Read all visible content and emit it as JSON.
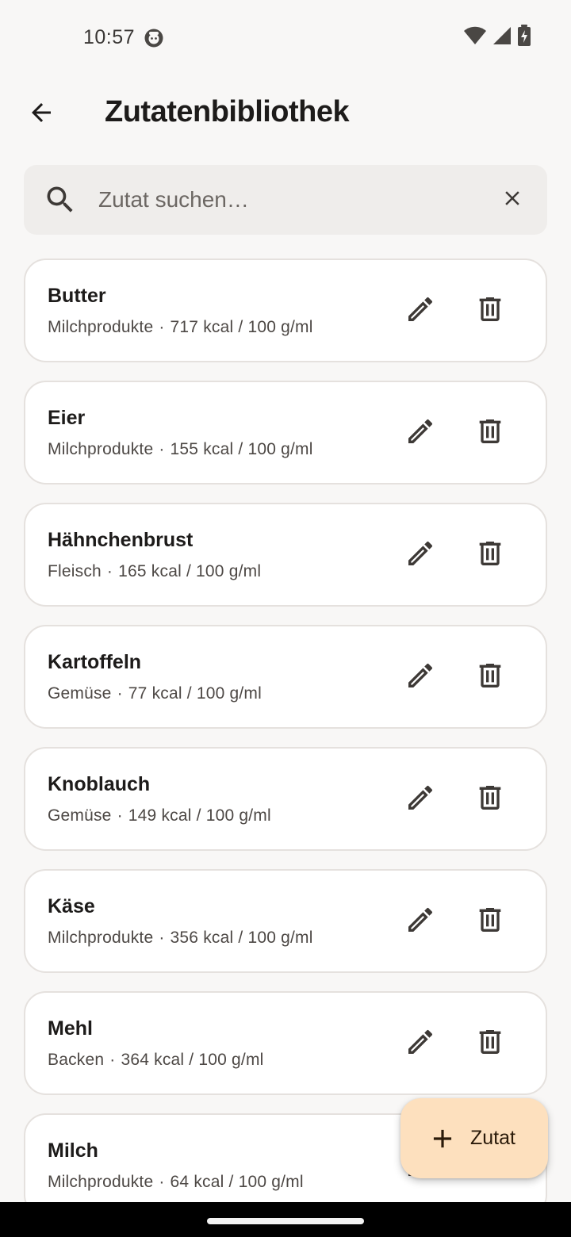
{
  "status_bar": {
    "time": "10:57",
    "icons": [
      "app-notification-icon",
      "wifi-icon",
      "cell-signal-icon",
      "battery-charging-icon"
    ]
  },
  "app_bar": {
    "back_icon": "arrow-back-icon",
    "title": "Zutatenbibliothek"
  },
  "search": {
    "placeholder": "Zutat suchen…",
    "value": "",
    "icon": "search-icon",
    "clear_icon": "close-icon"
  },
  "ingredients": [
    {
      "name": "Butter",
      "category": "Milchprodukte",
      "kcal": "717 kcal / 100 g/ml"
    },
    {
      "name": "Eier",
      "category": "Milchprodukte",
      "kcal": "155 kcal / 100 g/ml"
    },
    {
      "name": "Hähnchenbrust",
      "category": "Fleisch",
      "kcal": "165 kcal / 100 g/ml"
    },
    {
      "name": "Kartoffeln",
      "category": "Gemüse",
      "kcal": "77 kcal / 100 g/ml"
    },
    {
      "name": "Knoblauch",
      "category": "Gemüse",
      "kcal": "149 kcal / 100 g/ml"
    },
    {
      "name": "Käse",
      "category": "Milchprodukte",
      "kcal": "356 kcal / 100 g/ml"
    },
    {
      "name": "Mehl",
      "category": "Backen",
      "kcal": "364 kcal / 100 g/ml"
    },
    {
      "name": "Milch",
      "category": "Milchprodukte",
      "kcal": "64 kcal / 100 g/ml"
    }
  ],
  "row_actions": {
    "edit_icon": "pencil-icon",
    "delete_icon": "trash-icon",
    "meta_separator": "·"
  },
  "fab": {
    "icon": "plus-icon",
    "label": "Zutat"
  },
  "colors": {
    "background": "#f8f7f6",
    "card": "#ffffff",
    "card_border": "#e5e1de",
    "search_field": "#efedeb",
    "fab": "#fde0be",
    "text_primary": "#1d1b1a",
    "text_secondary": "#4d4845"
  }
}
